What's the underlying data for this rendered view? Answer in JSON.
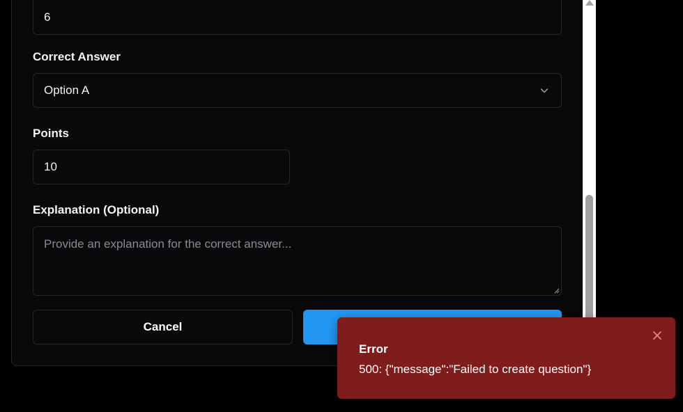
{
  "form": {
    "prev_field_value": "6",
    "correct_answer": {
      "label": "Correct Answer",
      "selected": "Option A"
    },
    "points": {
      "label": "Points",
      "value": "10"
    },
    "explanation": {
      "label": "Explanation (Optional)",
      "placeholder": "Provide an explanation for the correct answer..."
    },
    "buttons": {
      "cancel": "Cancel",
      "submit": ""
    }
  },
  "toast": {
    "title": "Error",
    "message": "500: {\"message\":\"Failed to create question\"}"
  },
  "colors": {
    "background": "#000000",
    "card": "#09090b",
    "border": "#27272a",
    "primary": "#2196f3",
    "error_toast": "#7f1d1d"
  },
  "icons": {
    "select": "chevron-down-icon",
    "toast_close": "close-icon"
  }
}
